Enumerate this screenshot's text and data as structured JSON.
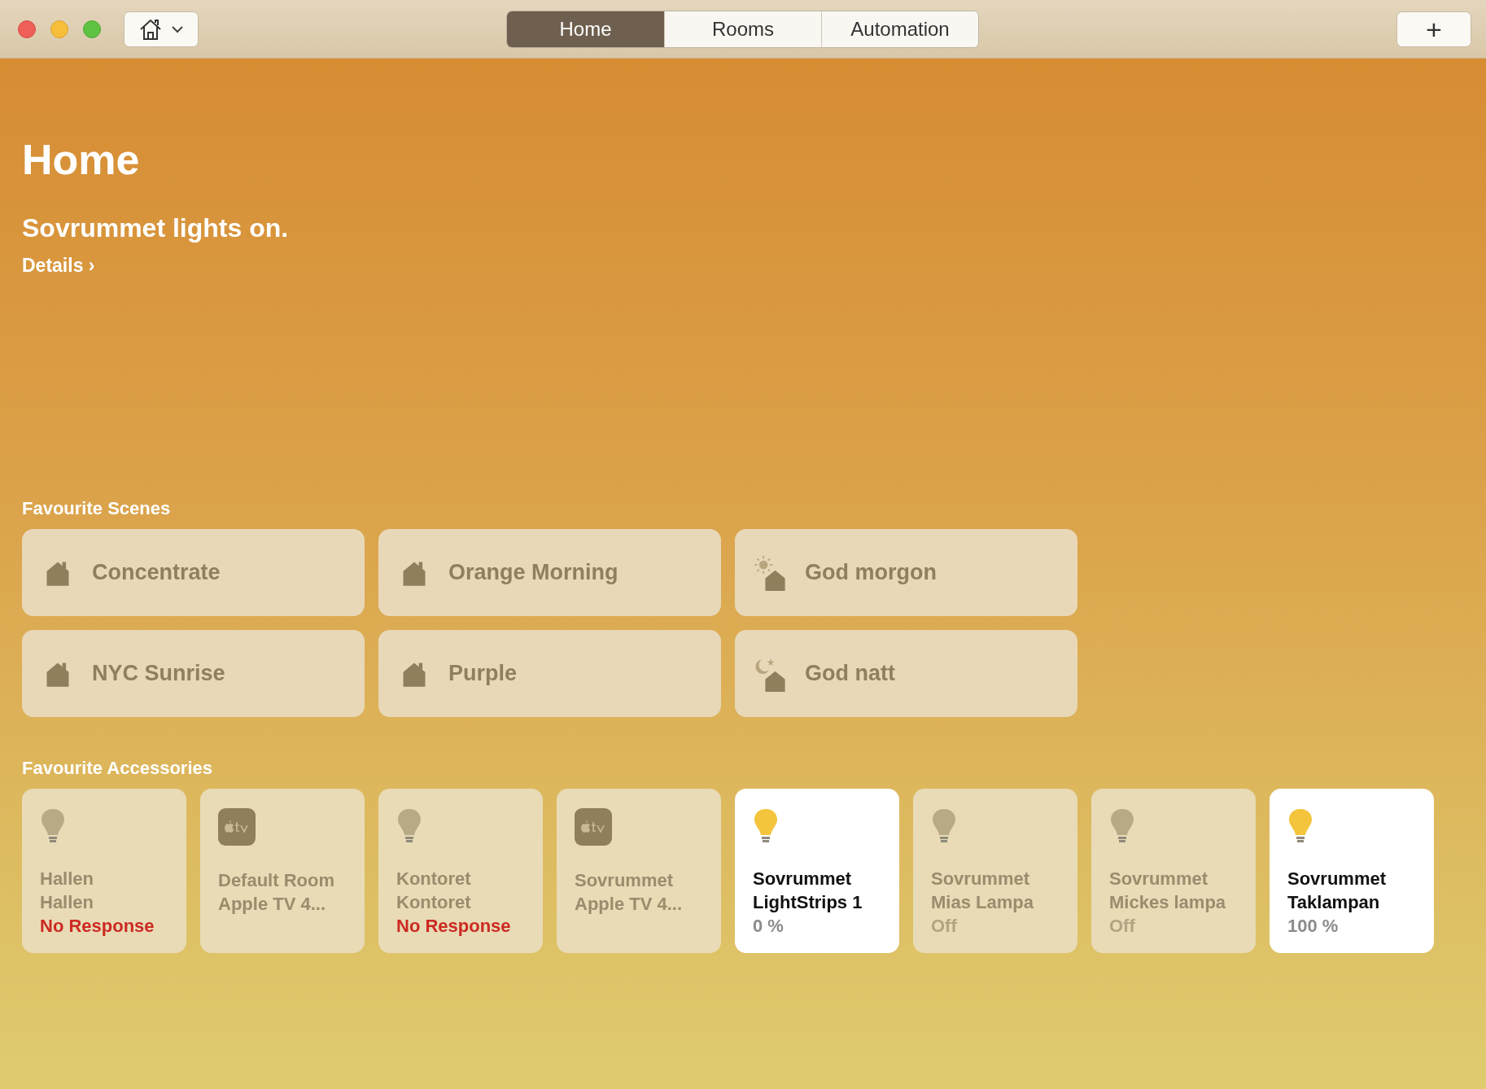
{
  "window": {
    "tabs": [
      {
        "label": "Home",
        "selected": true
      },
      {
        "label": "Rooms",
        "selected": false
      },
      {
        "label": "Automation",
        "selected": false
      }
    ],
    "add_button": "+"
  },
  "title": "Home",
  "status": {
    "headline": "Sovrummet lights on.",
    "link": "Details ›"
  },
  "scenes": {
    "heading": "Favourite Scenes",
    "items": [
      {
        "name": "Concentrate",
        "kind": "home"
      },
      {
        "name": "Orange Morning",
        "kind": "home"
      },
      {
        "name": "God morgon",
        "kind": "morning"
      },
      {
        "name": "NYC Sunrise",
        "kind": "home"
      },
      {
        "name": "Purple",
        "kind": "home"
      },
      {
        "name": "God natt",
        "kind": "night"
      }
    ]
  },
  "accessories": {
    "heading": "Favourite Accessories",
    "items": [
      {
        "kind": "light",
        "room": "Hallen",
        "name": "Hallen",
        "status": "No Response",
        "on": false,
        "unreachable": true
      },
      {
        "kind": "tv",
        "room": "Default Room",
        "name": "Apple TV 4...",
        "on": false
      },
      {
        "kind": "light",
        "room": "Kontoret",
        "name": "Kontoret",
        "status": "No Response",
        "on": false,
        "unreachable": true
      },
      {
        "kind": "tv",
        "room": "Sovrummet",
        "name": "Apple TV 4...",
        "on": false
      },
      {
        "kind": "light",
        "room": "Sovrummet",
        "name": "LightStrips 1",
        "status": "0 %",
        "on": true,
        "unreachable": false
      },
      {
        "kind": "light",
        "room": "Sovrummet",
        "name": "Mias Lampa",
        "status": "Off",
        "on": false,
        "unreachable": false
      },
      {
        "kind": "light",
        "room": "Sovrummet",
        "name": "Mickes lampa",
        "status": "Off",
        "on": false,
        "unreachable": false
      },
      {
        "kind": "light",
        "room": "Sovrummet",
        "name": "Taklampan",
        "status": "100 %",
        "on": true,
        "unreachable": false
      }
    ]
  }
}
